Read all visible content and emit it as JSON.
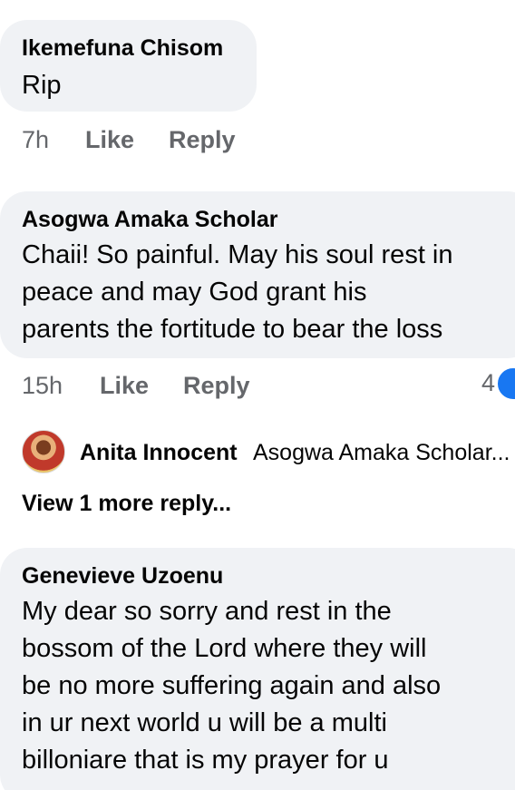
{
  "comments": [
    {
      "author": "Ikemefuna Chisom",
      "lines": [
        "Rip"
      ],
      "time": "7h",
      "like_label": "Like",
      "reply_label": "Reply"
    },
    {
      "author": "Asogwa Amaka Scholar",
      "lines": [
        "Chaii! So painful. May his soul rest in",
        "peace and may God  grant his",
        "parents the fortitude to bear the loss"
      ],
      "time": "15h",
      "like_label": "Like",
      "reply_label": "Reply",
      "reaction_count": "4",
      "reaction_icon": "like-icon",
      "replies": [
        {
          "author": "Anita Innocent",
          "preview": "Asogwa Amaka Scholar..."
        }
      ],
      "view_more_label": "View 1 more reply..."
    },
    {
      "author": "Genevieve Uzoenu",
      "lines": [
        "My dear so sorry and rest in the",
        "bossom of the Lord where they will",
        "be no more suffering again and also",
        "in ur next world u will be a multi",
        "billoniare that is my prayer for u"
      ]
    }
  ],
  "colors": {
    "bubble": "#f0f2f5",
    "text": "#050505",
    "meta": "#65676b",
    "like_blue": "#1877f2"
  }
}
